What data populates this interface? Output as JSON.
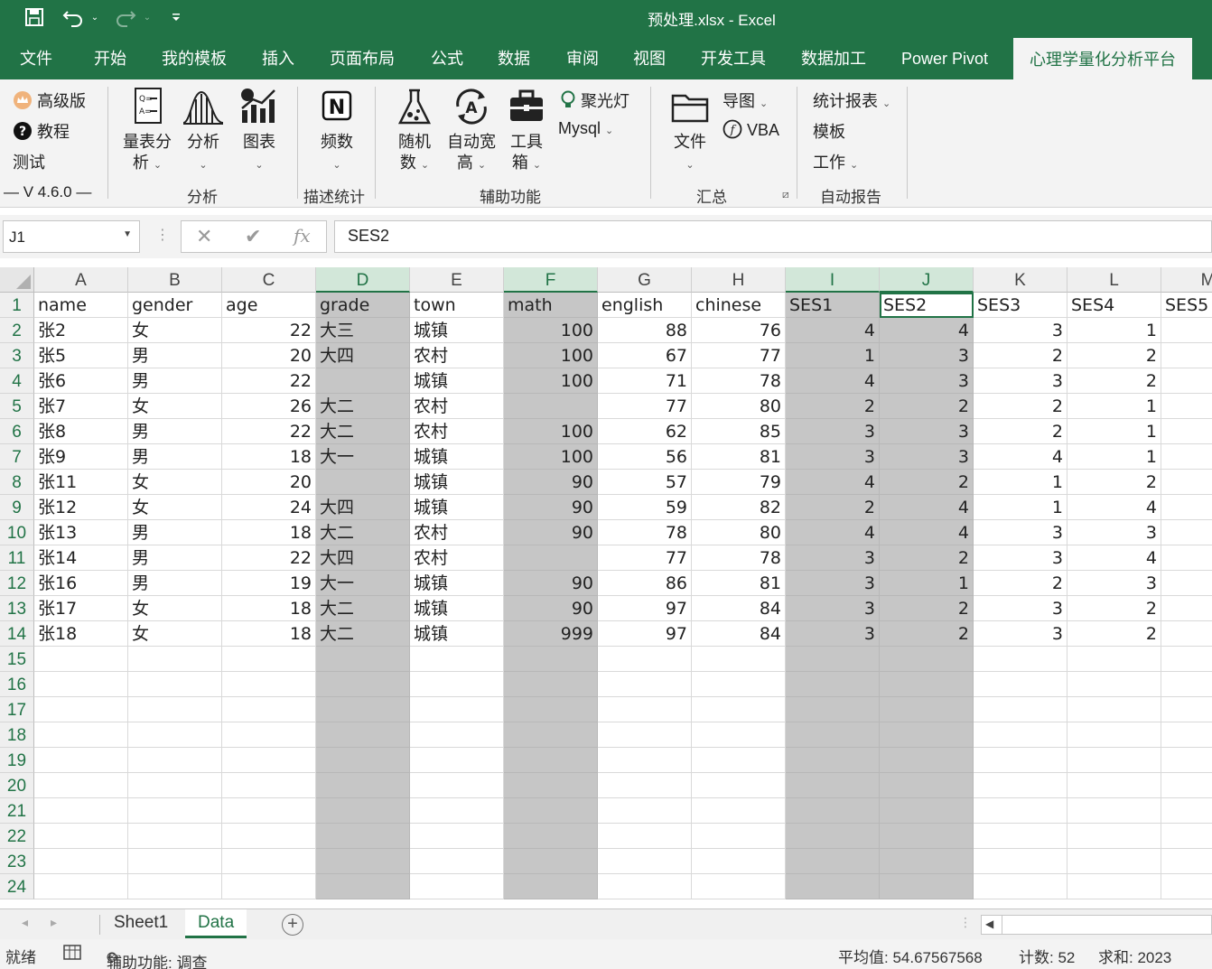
{
  "titlebar": {
    "title": "预处理.xlsx  -  Excel",
    "save_icon": "save-icon",
    "undo_icon": "undo-icon",
    "redo_icon": "redo-icon",
    "customize_icon": "customize-quick-access-icon"
  },
  "tabs": [
    "文件",
    "开始",
    "我的模板",
    "插入",
    "页面布局",
    "公式",
    "数据",
    "审阅",
    "视图",
    "开发工具",
    "数据加工",
    "Power Pivot",
    "心理学量化分析平台"
  ],
  "active_tab": "心理学量化分析平台",
  "ribbon": {
    "version_group": {
      "pro": "高级版",
      "tutorial": "教程",
      "test": "测试",
      "version": "V 4.6.0"
    },
    "analysis_group": {
      "label": "分析",
      "scale": "量表分析",
      "analysis": "分析",
      "chart": "图表"
    },
    "desc_group": {
      "label": "描述统计",
      "freq": "频数"
    },
    "aux_group": {
      "label": "辅助功能",
      "random": "随机数",
      "autofit": "自动宽高",
      "toolbox": "工具箱",
      "spotlight": "聚光灯",
      "mysql": "Mysql"
    },
    "summary_group": {
      "label": "汇总",
      "file": "文件",
      "export_chart": "导图",
      "vba": "VBA"
    },
    "report_group": {
      "label": "自动报告",
      "stats_report": "统计报表",
      "template": "模板",
      "work": "工作"
    }
  },
  "formula_bar": {
    "name_box": "J1",
    "cancel": "✕",
    "confirm": "✔",
    "fx": "fx",
    "value": "SES2"
  },
  "columns": [
    "A",
    "B",
    "C",
    "D",
    "E",
    "F",
    "G",
    "H",
    "I",
    "J",
    "K",
    "L",
    "M"
  ],
  "rows": [
    [
      "name",
      "gender",
      "age",
      "grade",
      "town",
      "math",
      "english",
      "chinese",
      "SES1",
      "SES2",
      "SES3",
      "SES4",
      "SES5"
    ],
    [
      "张2",
      "女",
      "22",
      "大三",
      "城镇",
      "100",
      "88",
      "76",
      "4",
      "4",
      "3",
      "1",
      ""
    ],
    [
      "张5",
      "男",
      "20",
      "大四",
      "农村",
      "100",
      "67",
      "77",
      "1",
      "3",
      "2",
      "2",
      ""
    ],
    [
      "张6",
      "男",
      "22",
      "",
      "城镇",
      "100",
      "71",
      "78",
      "4",
      "3",
      "3",
      "2",
      ""
    ],
    [
      "张7",
      "女",
      "26",
      "大二",
      "农村",
      "",
      "77",
      "80",
      "2",
      "2",
      "2",
      "1",
      ""
    ],
    [
      "张8",
      "男",
      "22",
      "大二",
      "农村",
      "100",
      "62",
      "85",
      "3",
      "3",
      "2",
      "1",
      ""
    ],
    [
      "张9",
      "男",
      "18",
      "大一",
      "城镇",
      "100",
      "56",
      "81",
      "3",
      "3",
      "4",
      "1",
      ""
    ],
    [
      "张11",
      "女",
      "20",
      "",
      "城镇",
      "90",
      "57",
      "79",
      "4",
      "2",
      "1",
      "2",
      ""
    ],
    [
      "张12",
      "女",
      "24",
      "大四",
      "城镇",
      "90",
      "59",
      "82",
      "2",
      "4",
      "1",
      "4",
      ""
    ],
    [
      "张13",
      "男",
      "18",
      "大二",
      "农村",
      "90",
      "78",
      "80",
      "4",
      "4",
      "3",
      "3",
      ""
    ],
    [
      "张14",
      "男",
      "22",
      "大四",
      "农村",
      "",
      "77",
      "78",
      "3",
      "2",
      "3",
      "4",
      ""
    ],
    [
      "张16",
      "男",
      "19",
      "大一",
      "城镇",
      "90",
      "86",
      "81",
      "3",
      "1",
      "2",
      "3",
      ""
    ],
    [
      "张17",
      "女",
      "18",
      "大二",
      "城镇",
      "90",
      "97",
      "84",
      "3",
      "2",
      "3",
      "2",
      ""
    ],
    [
      "张18",
      "女",
      "18",
      "大二",
      "城镇",
      "999",
      "97",
      "84",
      "3",
      "2",
      "3",
      "2",
      ""
    ]
  ],
  "row_numbers": [
    "1",
    "2",
    "3",
    "4",
    "5",
    "6",
    "7",
    "8",
    "9",
    "10",
    "11",
    "12",
    "13",
    "14",
    "15",
    "16",
    "17",
    "18",
    "19",
    "20",
    "21",
    "22",
    "23",
    "24"
  ],
  "selected_columns": [
    "D",
    "F",
    "I",
    "J"
  ],
  "active_cell": "J1",
  "sheets": [
    "Sheet1",
    "Data"
  ],
  "active_sheet": "Data",
  "status": {
    "ready": "就绪",
    "accessibility": "辅助功能: 调查",
    "average": "平均值: 54.67567568",
    "count": "计数: 52",
    "sum": "求和: 2023"
  },
  "colors": {
    "brand": "#217346",
    "selection": "#c6c6c6"
  }
}
